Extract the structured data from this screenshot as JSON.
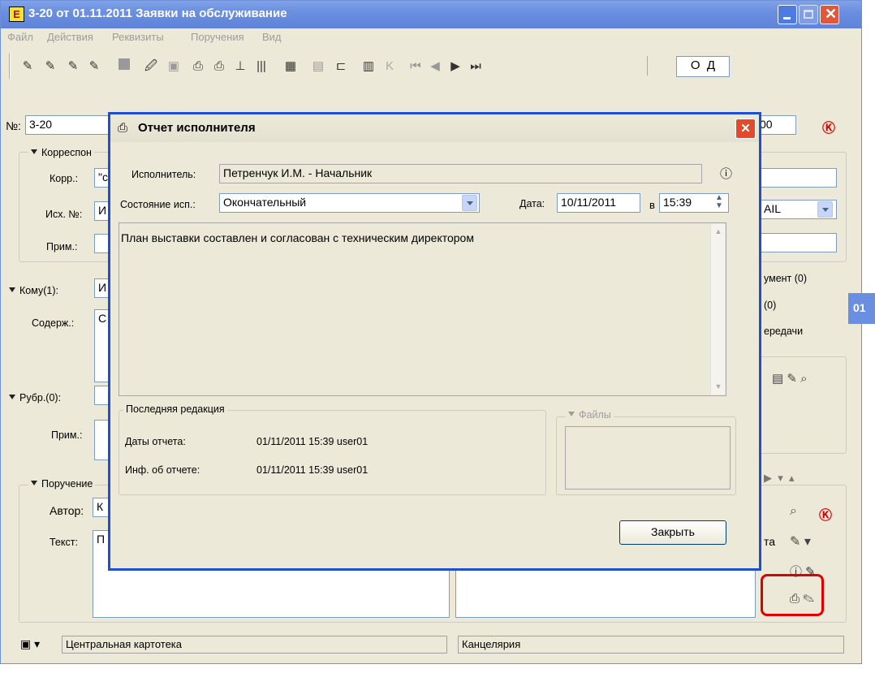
{
  "window": {
    "title": "3-20 от 01.11.2011 Заявки на обслуживание",
    "app_icon": "Е"
  },
  "menu": [
    "Файл",
    "Действия",
    "Реквизиты",
    "Поручения",
    "Вид"
  ],
  "toolbar": {
    "view_o": "О",
    "view_d": "Д"
  },
  "form": {
    "number_label": "№:",
    "number_value": "3-20",
    "number_tail": "00",
    "corr_group": "Корреспон",
    "korr_label": "Корр.:",
    "korr_value": "\"с",
    "isx_label": "Исх. №:",
    "isx_value": "И",
    "prim_label": "Прим.:",
    "komu_label": "Кому(1):",
    "komu_value": "И",
    "soderzh_label": "Содерж.:",
    "soderzh_value": "С",
    "rubr_label": "Рубр.(0):",
    "prim2_label": "Прим.:",
    "poruch_group": "Поручение",
    "avtor_label": "Автор:",
    "avtor_value": "К",
    "tekst_label": "Текст:",
    "tekst_value": "П",
    "right_ail": "AIL",
    "right_doc": "умент (0)",
    "right_zero": "(0)",
    "right_peredachi": "ередачи",
    "right_sta": "та",
    "side_num": "01"
  },
  "statusbar": {
    "left": "Центральная картотека",
    "right": "Канцелярия"
  },
  "dialog": {
    "title": "Отчет исполнителя",
    "executor_label": "Исполнитель:",
    "executor_value": "Петренчук И.М. - Начальник",
    "state_label": "Состояние исп.:",
    "state_value": "Окончательный",
    "date_label": "Дата:",
    "date_value": "10/11/2011",
    "time_prefix": "в",
    "time_value": "15:39",
    "report_text": "План выставки составлен и согласован с техническим директором",
    "last_edit_group": "Последняя редакция",
    "report_dates_label": "Даты отчета:",
    "report_dates_value": "01/11/2011 15:39  user01",
    "report_info_label": "Инф. об отчете:",
    "report_info_value": "01/11/2011 15:39  user01",
    "files_group": "Файлы",
    "close_button": "Закрыть"
  },
  "colors": {
    "titlebar": "#6b8fe0",
    "dialog_border": "#1e4fd2",
    "highlight": "#e00000",
    "panel": "#ece9d8"
  }
}
